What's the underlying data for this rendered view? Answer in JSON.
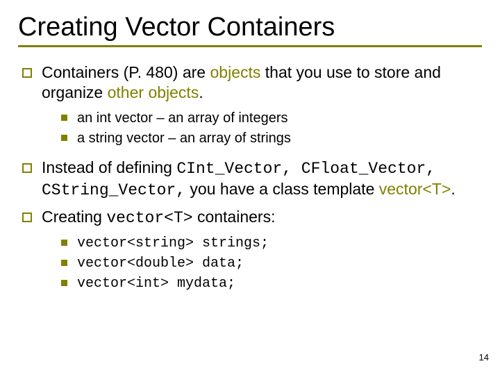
{
  "title": "Creating Vector Containers",
  "p1": {
    "pre": "Containers (P. 480) are ",
    "hl1": "objects",
    "mid": " that you use to store and organize ",
    "hl2": "other objects",
    "post": "."
  },
  "sub1a": "an int vector – an array of integers",
  "sub1b": "a string vector – an array of strings",
  "p2": {
    "pre": "Instead of defining ",
    "c1": "CInt_Vector, CFloat_Vector, CString_Vector,",
    "mid": " you have a class template ",
    "hl": "vector<T>",
    "post": "."
  },
  "p3": {
    "pre": "Creating ",
    "c": "vector<T>",
    "post": " containers:"
  },
  "ex1": "vector<string> strings;",
  "ex2": "vector<double> data;",
  "ex3": "vector<int> mydata;",
  "page": "14"
}
